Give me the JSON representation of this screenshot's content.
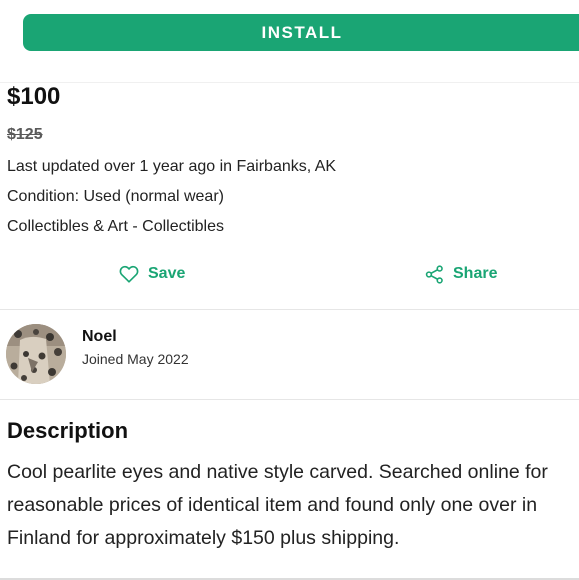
{
  "install_button": {
    "label": "INSTALL"
  },
  "listing": {
    "price": "$100",
    "original_price": "$125",
    "updated": "Last updated over 1 year ago in Fairbanks, AK",
    "condition": "Condition: Used (normal wear)",
    "category": "Collectibles & Art - Collectibles"
  },
  "actions": {
    "save_label": "Save",
    "share_label": "Share",
    "save_icon": "heart-icon",
    "share_icon": "share-icon"
  },
  "seller": {
    "name": "Noel",
    "joined": "Joined May 2022"
  },
  "description": {
    "heading": "Description",
    "text": "Cool pearlite eyes and native style carved. Searched online for reasonable prices of identical item and found only one over in Finland for approximately $150 plus shipping."
  },
  "colors": {
    "accent": "#1aa574",
    "text": "#222222",
    "divider": "#e6e6e6"
  }
}
